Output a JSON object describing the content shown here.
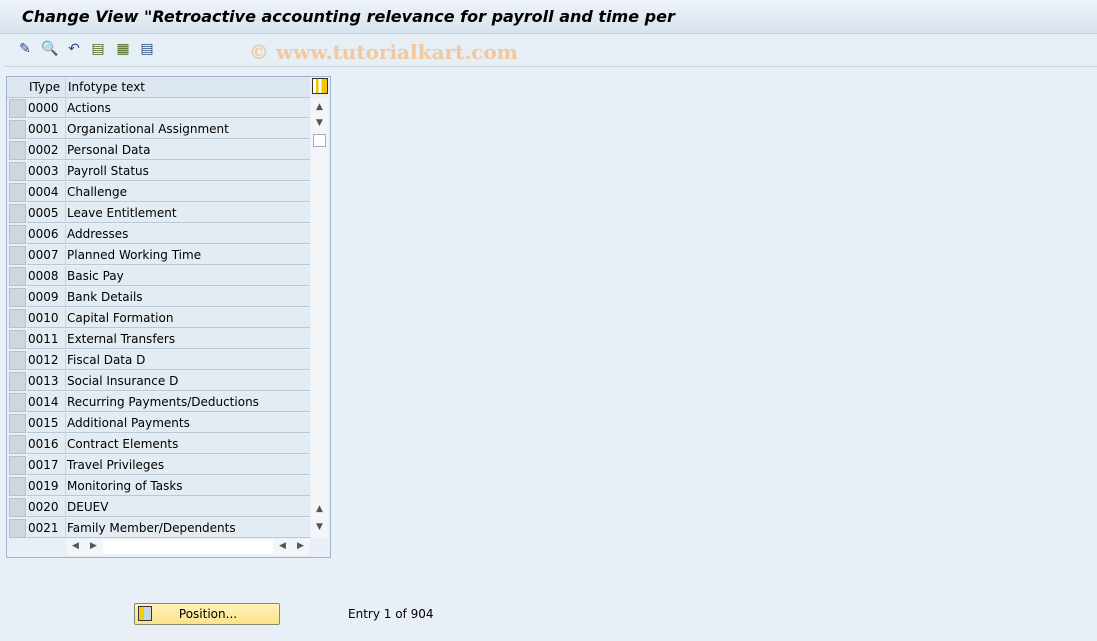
{
  "title": "Change View \"Retroactive accounting relevance for payroll and time per",
  "toolbar": {
    "icons": [
      "display-change-icon",
      "details-icon",
      "undo-icon",
      "select-all-icon",
      "select-block-icon",
      "deselect-all-icon"
    ]
  },
  "watermark": "© www.tutorialkart.com",
  "table": {
    "headers": [
      "IType",
      "Infotype text"
    ],
    "rows": [
      [
        "0000",
        "Actions"
      ],
      [
        "0001",
        "Organizational Assignment"
      ],
      [
        "0002",
        "Personal Data"
      ],
      [
        "0003",
        "Payroll Status"
      ],
      [
        "0004",
        "Challenge"
      ],
      [
        "0005",
        "Leave Entitlement"
      ],
      [
        "0006",
        "Addresses"
      ],
      [
        "0007",
        "Planned Working Time"
      ],
      [
        "0008",
        "Basic Pay"
      ],
      [
        "0009",
        "Bank Details"
      ],
      [
        "0010",
        "Capital Formation"
      ],
      [
        "0011",
        "External Transfers"
      ],
      [
        "0012",
        "Fiscal Data  D"
      ],
      [
        "0013",
        "Social Insurance  D"
      ],
      [
        "0014",
        "Recurring Payments/Deductions"
      ],
      [
        "0015",
        "Additional Payments"
      ],
      [
        "0016",
        "Contract Elements"
      ],
      [
        "0017",
        "Travel Privileges"
      ],
      [
        "0019",
        "Monitoring of Tasks"
      ],
      [
        "0020",
        "DEUEV"
      ],
      [
        "0021",
        "Family Member/Dependents"
      ]
    ]
  },
  "position_button": "Position...",
  "entry_text": "Entry 1 of 904"
}
